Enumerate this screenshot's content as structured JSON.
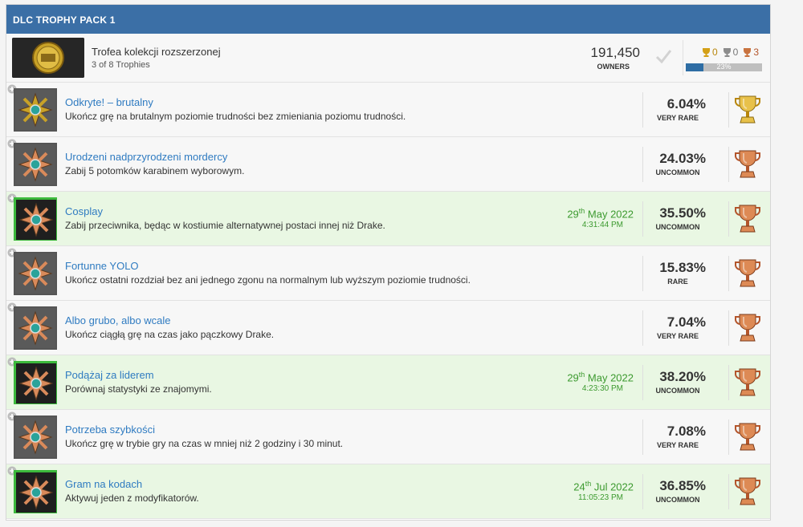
{
  "header": {
    "title": "DLC TROPHY PACK 1"
  },
  "pack": {
    "title": "Trofea kolekcji rozszerzonej",
    "subtitle": "3 of 8 Trophies",
    "owners": "191,450",
    "owners_label": "OWNERS",
    "counts": {
      "gold": "0",
      "silver": "0",
      "bronze": "3"
    },
    "progress": 23,
    "progress_label": "23%"
  },
  "trophies": [
    {
      "name": "Odkryte! – brutalny",
      "desc": "Ukończ grę na brutalnym poziomie trudności bez zmieniania poziomu trudności.",
      "pct": "6.04%",
      "rarity": "VERY RARE",
      "earned": false,
      "cup": "gold"
    },
    {
      "name": "Urodzeni nadprzyrodzeni mordercy",
      "desc": "Zabij 5 potomków karabinem wyborowym.",
      "pct": "24.03%",
      "rarity": "UNCOMMON",
      "earned": false,
      "cup": "bronze"
    },
    {
      "name": "Cosplay",
      "desc": "Zabij przeciwnika, będąc w kostiumie alternatywnej postaci innej niż Drake.",
      "date_day": "29",
      "date_sup": "th",
      "date_rest": " May 2022",
      "time": "4:31:44 PM",
      "pct": "35.50%",
      "rarity": "UNCOMMON",
      "earned": true,
      "cup": "bronze"
    },
    {
      "name": "Fortunne YOLO",
      "desc": "Ukończ ostatni rozdział bez ani jednego zgonu na normalnym lub wyższym poziomie trudności.",
      "pct": "15.83%",
      "rarity": "RARE",
      "earned": false,
      "cup": "bronze"
    },
    {
      "name": "Albo grubo, albo wcale",
      "desc": "Ukończ ciągłą grę na czas jako pączkowy Drake.",
      "pct": "7.04%",
      "rarity": "VERY RARE",
      "earned": false,
      "cup": "bronze"
    },
    {
      "name": "Podążaj za liderem",
      "desc": "Porównaj statystyki ze znajomymi.",
      "date_day": "29",
      "date_sup": "th",
      "date_rest": " May 2022",
      "time": "4:23:30 PM",
      "pct": "38.20%",
      "rarity": "UNCOMMON",
      "earned": true,
      "cup": "bronze"
    },
    {
      "name": "Potrzeba szybkości",
      "desc": "Ukończ grę w trybie gry na czas w mniej niż 2 godziny i 30 minut.",
      "pct": "7.08%",
      "rarity": "VERY RARE",
      "earned": false,
      "cup": "bronze"
    },
    {
      "name": "Gram na kodach",
      "desc": "Aktywuj jeden z modyfikatorów.",
      "date_day": "24",
      "date_sup": "th",
      "date_rest": " Jul 2022",
      "time": "11:05:23 PM",
      "pct": "36.85%",
      "rarity": "UNCOMMON",
      "earned": true,
      "cup": "bronze"
    }
  ],
  "colors": {
    "header": "#3b6fa6",
    "link": "#2f7bc1",
    "earned_bg": "#e9f7e3",
    "earned_border": "#3cb93c",
    "gold": "#d4a017",
    "bronze": "#c9733f"
  }
}
